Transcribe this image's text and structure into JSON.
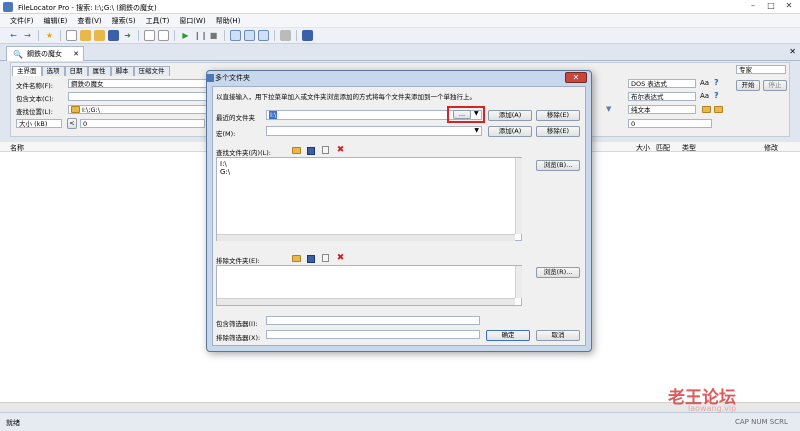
{
  "window": {
    "title": "FileLocator Pro - 搜索: I:\\;G:\\ (鋼鉄の魔女)"
  },
  "menu": [
    "文件(F)",
    "编辑(E)",
    "查看(V)",
    "搜索(S)",
    "工具(T)",
    "窗口(W)",
    "帮助(H)"
  ],
  "doc_tab": {
    "label": "鋼鉄の魔女"
  },
  "subtabs": [
    "主界面",
    "选项",
    "日期",
    "属性",
    "脚本",
    "压缩文件"
  ],
  "main_form": {
    "file_name_label": "文件名称(F):",
    "file_name_value": "鋼鉄の魔女",
    "contains_text_label": "包含文本(C):",
    "look_in_label": "查找位置(L):",
    "look_in_value": "I:\\;G:\\",
    "size_select": "大小 (kB)",
    "size_from": "0",
    "size_to": "0",
    "expr_type_1": "DOS 表达式",
    "expr_type_2": "布尔表达式",
    "text_type": "纯文本",
    "aa": "Aa",
    "help": "?",
    "profile_select": "专家",
    "start_button": "开始",
    "stop_button": "停止"
  },
  "results_header": {
    "name": "名称",
    "size": "大小",
    "match": "匹配",
    "type": "类型",
    "modified": "修改"
  },
  "status": {
    "left": "就绪",
    "right": "CAP NUM SCRL"
  },
  "watermark": {
    "text": "老王论坛",
    "sub": "laowang.vip"
  },
  "dialog": {
    "title": "多个文件夹",
    "intro": "以直接输入，用下拉菜单加入或文件夹浏览添加的方式将每个文件夹添加到一个单独行上。",
    "recent_label": "最近的文件夹",
    "recent_value": "I:\\",
    "recent_ellipsis": "...",
    "add_button": "添加(A)",
    "remove_button": "移除(E)",
    "macro_label": "宏(M):",
    "macro_add_button": "添加(A)",
    "macro_remove_button": "移除(E)",
    "search_folders_label": "查找文件夹(内)(L):",
    "search_folders": [
      "I:\\",
      "G:\\"
    ],
    "browse_button": "浏览(B)...",
    "exclude_folders_label": "排除文件夹(E):",
    "exclude_browse_button": "浏览(R)...",
    "include_filter_label": "包含筛选器(I):",
    "exclude_filter_label": "排除筛选器(X):",
    "ok_button": "确定",
    "cancel_button": "取消"
  },
  "colors": {
    "accent": "#4a78b8",
    "highlight_box": "#d62424",
    "watermark": "#d94a4a"
  }
}
